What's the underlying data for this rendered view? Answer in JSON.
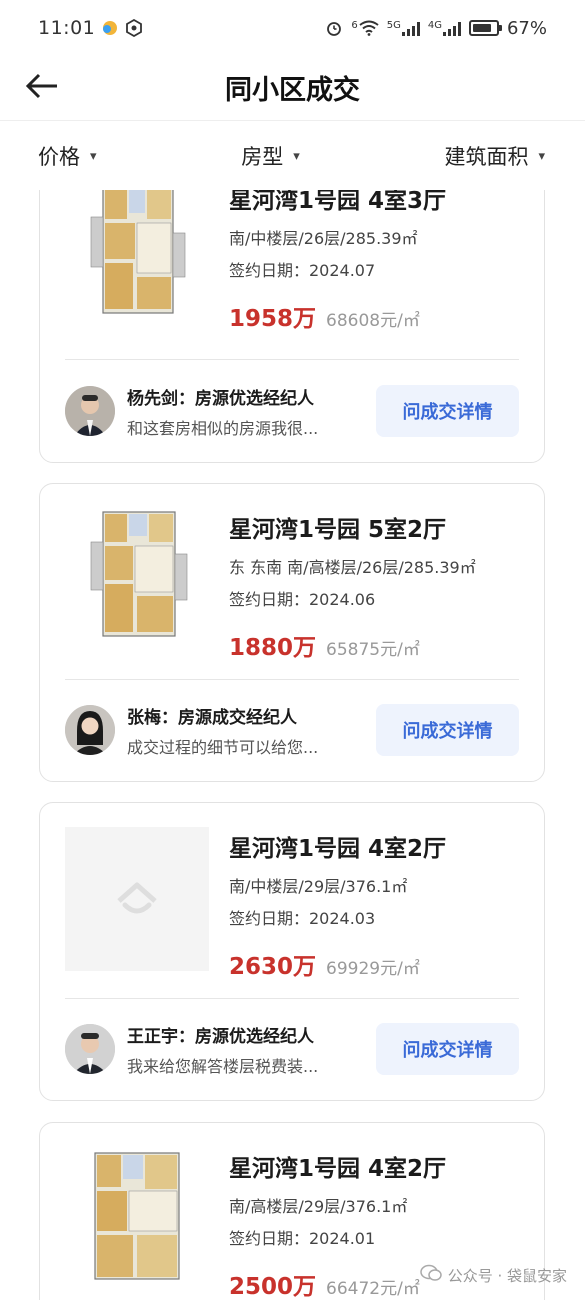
{
  "status_bar": {
    "time": "11:01",
    "net_label_1": "6",
    "net_label_2": "5G",
    "net_label_3": "4G",
    "battery": "67%"
  },
  "nav": {
    "title": "同小区成交"
  },
  "filters": [
    {
      "label": "价格"
    },
    {
      "label": "房型"
    },
    {
      "label": "建筑面积"
    }
  ],
  "listings": [
    {
      "title": "星河湾1号园 4室3厅",
      "meta": "南/中楼层/26层/285.39㎡",
      "date": "签约日期：2024.07",
      "price": "1958万",
      "unit_price": "68608元/㎡",
      "agent_name": "杨先剑：房源优选经纪人",
      "agent_message": "和这套房相似的房源我很...",
      "button": "问成交详情",
      "has_floorplan": true
    },
    {
      "title": "星河湾1号园 5室2厅",
      "meta": "东 东南 南/高楼层/26层/285.39㎡",
      "date": "签约日期：2024.06",
      "price": "1880万",
      "unit_price": "65875元/㎡",
      "agent_name": "张梅：房源成交经纪人",
      "agent_message": "成交过程的细节可以给您...",
      "button": "问成交详情",
      "has_floorplan": true
    },
    {
      "title": "星河湾1号园 4室2厅",
      "meta": "南/中楼层/29层/376.1㎡",
      "date": "签约日期：2024.03",
      "price": "2630万",
      "unit_price": "69929元/㎡",
      "agent_name": "王正宇：房源优选经纪人",
      "agent_message": "我来给您解答楼层税费装...",
      "button": "问成交详情",
      "has_floorplan": false
    },
    {
      "title": "星河湾1号园 4室2厅",
      "meta": "南/高楼层/29层/376.1㎡",
      "date": "签约日期：2024.01",
      "price": "2500万",
      "unit_price": "66472元/㎡",
      "has_floorplan": true
    }
  ],
  "watermark": "公众号 · 袋鼠安家",
  "colors": {
    "price": "#c8322c",
    "button_bg": "#eef3fd",
    "button_text": "#3a6ad7"
  }
}
